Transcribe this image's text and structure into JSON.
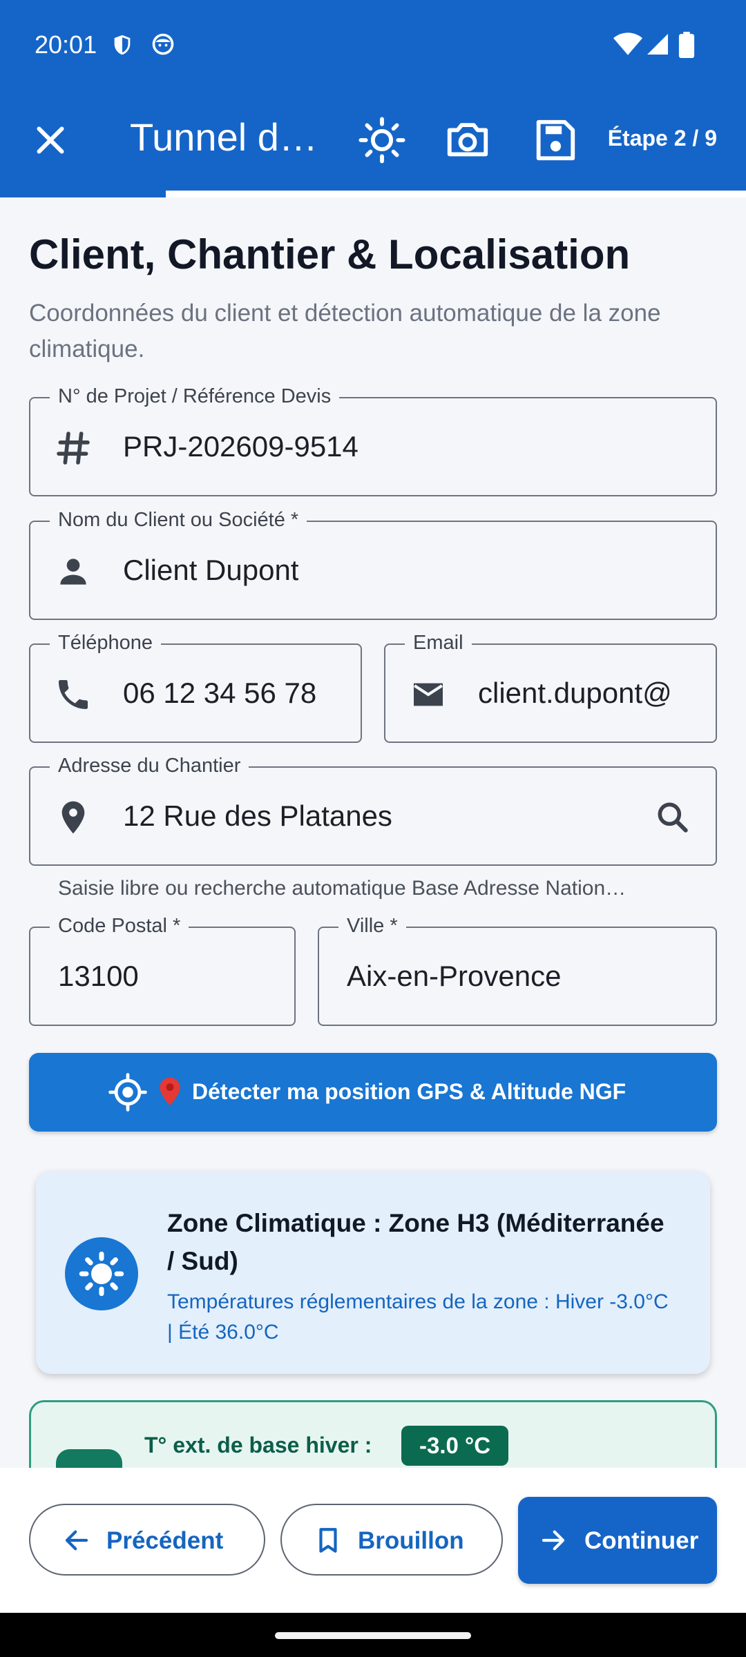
{
  "status": {
    "time": "20:01",
    "icons": [
      "shield-icon",
      "face-icon",
      "wifi-icon",
      "signal-icon",
      "battery-icon"
    ]
  },
  "appbar": {
    "title": "Tunnel d",
    "step": "Étape 2 / 9",
    "progress": 0.222
  },
  "section": {
    "title": "Client, Chantier & Localisation",
    "subtitle": "Coordonnées du client et détection automatique de la zone climatique."
  },
  "fields": {
    "project": {
      "label": "N° de Projet / Référence Devis",
      "value": "PRJ-202609-9514"
    },
    "client": {
      "label": "Nom du Client ou Société *",
      "value": "Client Dupont"
    },
    "phone": {
      "label": "Téléphone",
      "value": "06 12 34 56 78"
    },
    "email": {
      "label": "Email",
      "value": "client.dupont@"
    },
    "address": {
      "label": "Adresse du Chantier",
      "value": "12 Rue des Platanes",
      "helper": "Saisie libre ou recherche automatique Base Adresse Nation…"
    },
    "postal": {
      "label": "Code Postal *",
      "value": "13100"
    },
    "city": {
      "label": "Ville *",
      "value": "Aix-en-Provence"
    }
  },
  "gps_button": {
    "label": "Détecter ma position GPS & Altitude NGF"
  },
  "zone": {
    "title": "Zone Climatique : Zone H3 (Méditerranée / Sud)",
    "subtitle": "Températures réglementaires de la zone : Hiver -3.0°C | Été 36.0°C"
  },
  "temperature": {
    "label": "T° ext. de base hiver :",
    "value": "-3.0 °C"
  },
  "bottom": {
    "previous": "Précédent",
    "draft": "Brouillon",
    "next": "Continuer"
  },
  "colors": {
    "primary": "#1565c8",
    "zone_bg": "#e3effb",
    "temp_accent": "#0b6b50"
  }
}
